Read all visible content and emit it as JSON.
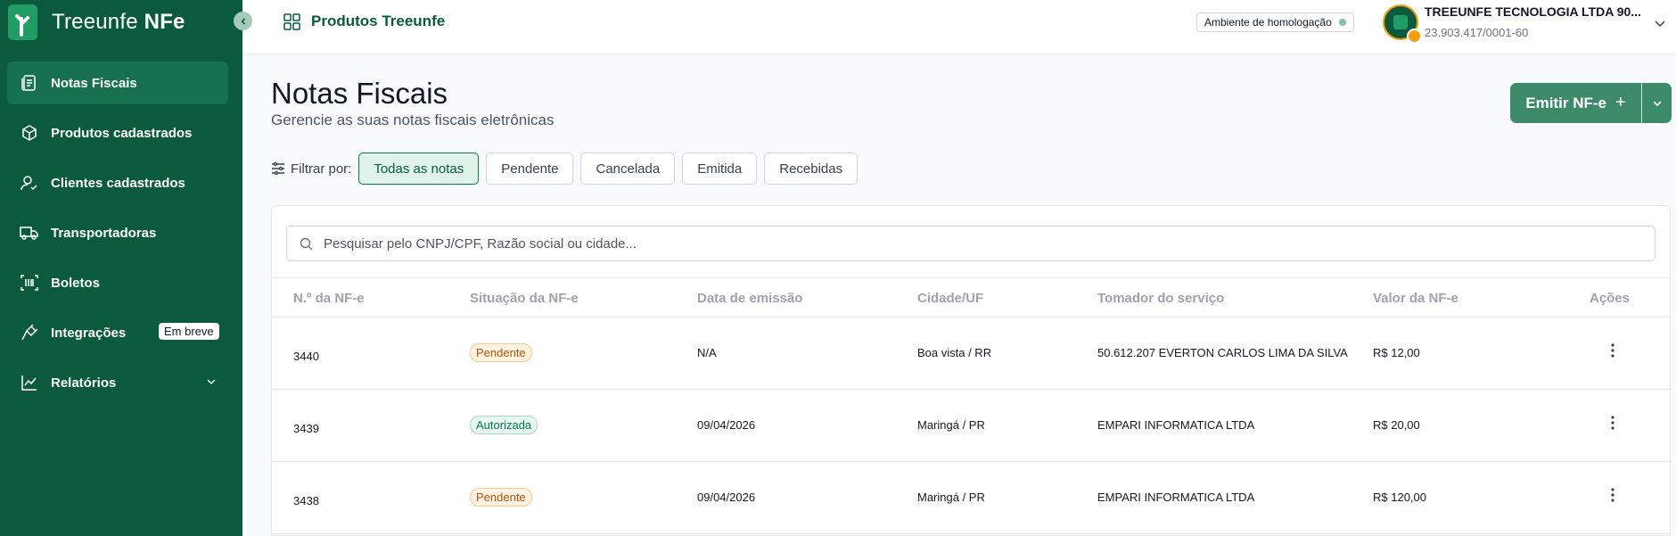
{
  "brand": {
    "name_light": "Treeunfe",
    "name_bold": "NFe"
  },
  "sidebar": {
    "items": [
      {
        "label": "Notas Fiscais",
        "icon": "document-icon",
        "active": true
      },
      {
        "label": "Produtos cadastrados",
        "icon": "box-icon"
      },
      {
        "label": "Clientes cadastrados",
        "icon": "user-check-icon"
      },
      {
        "label": "Transportadoras",
        "icon": "truck-icon"
      },
      {
        "label": "Boletos",
        "icon": "barcode-icon"
      },
      {
        "label": "Integrações",
        "icon": "plug-icon",
        "badge": "Em breve"
      },
      {
        "label": "Relatórios",
        "icon": "chart-icon",
        "expandable": true
      }
    ]
  },
  "topbar": {
    "title": "Produtos Treeunfe",
    "environment": "Ambiente de homologação",
    "company_name": "TREEUNFE TECNOLOGIA LTDA 90...",
    "company_cnpj": "23.903.417/0001-60"
  },
  "main": {
    "title": "Notas Fiscais",
    "subtitle": "Gerencie as suas notas fiscais eletrônicas",
    "emit_label": "Emitir NF-e",
    "filter_label": "Filtrar por:",
    "filters": [
      "Todas as notas",
      "Pendente",
      "Cancelada",
      "Emitida",
      "Recebidas"
    ],
    "active_filter": "Todas as notas",
    "search_placeholder": "Pesquisar pelo CNPJ/CPF, Razão social ou cidade..."
  },
  "table": {
    "headers": [
      "N.º da NF-e",
      "Situação da NF-e",
      "Data de emissão",
      "Cidade/UF",
      "Tomador do serviço",
      "Valor da NF-e",
      "Ações"
    ],
    "rows": [
      {
        "number": "3440",
        "status": "Pendente",
        "date": "N/A",
        "city": "Boa vista / RR",
        "taker": "50.612.207 EVERTON CARLOS LIMA DA SILVA",
        "value": "R$ 12,00"
      },
      {
        "number": "3439",
        "status": "Autorizada",
        "date": "09/04/2026",
        "city": "Maringá / PR",
        "taker": "EMPARI INFORMATICA LTDA",
        "value": "R$ 20,00"
      },
      {
        "number": "3438",
        "status": "Pendente",
        "date": "09/04/2026",
        "city": "Maringá / PR",
        "taker": "EMPARI INFORMATICA LTDA",
        "value": "R$ 120,00"
      }
    ]
  },
  "colors": {
    "sidebar": "#0b5a3e",
    "accent": "#3d8a6a",
    "pending": "#b45309",
    "authorized": "#047857"
  }
}
